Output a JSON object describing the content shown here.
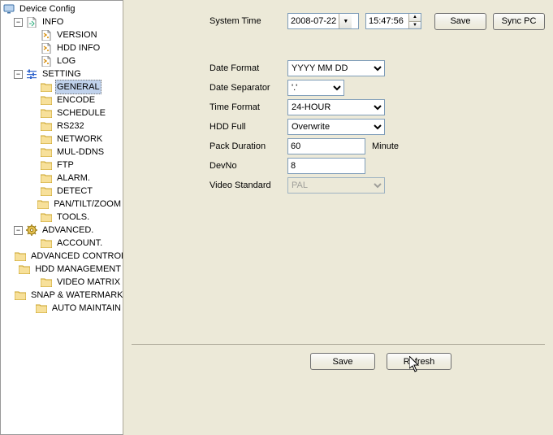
{
  "tree": {
    "root_label": "Device Config",
    "info": {
      "label": "INFO",
      "children": [
        "VERSION",
        "HDD INFO",
        "LOG"
      ]
    },
    "setting": {
      "label": "SETTING",
      "children": [
        "GENERAL",
        "ENCODE",
        "SCHEDULE",
        "RS232",
        "NETWORK",
        "MUL-DDNS",
        "FTP",
        "ALARM.",
        "DETECT",
        "PAN/TILT/ZOOM",
        "TOOLS."
      ]
    },
    "advanced": {
      "label": "ADVANCED.",
      "children": [
        "ACCOUNT.",
        "ADVANCED CONTROL.",
        "HDD MANAGEMENT",
        "VIDEO MATRIX",
        "SNAP & WATERMARK",
        "AUTO MAINTAIN"
      ]
    },
    "selected": "GENERAL"
  },
  "top": {
    "system_time_label": "System Time",
    "date_value": "2008-07-22",
    "time_value": "15:47:56",
    "save_label": "Save",
    "sync_label": "Sync PC"
  },
  "form": {
    "date_format_label": "Date Format",
    "date_format_value": "YYYY MM DD",
    "date_separator_label": "Date Separator",
    "date_separator_value": "'.'",
    "time_format_label": "Time Format",
    "time_format_value": "24-HOUR",
    "hdd_full_label": "HDD Full",
    "hdd_full_value": "Overwrite",
    "pack_duration_label": "Pack Duration",
    "pack_duration_value": "60",
    "pack_duration_unit": "Minute",
    "devno_label": "DevNo",
    "devno_value": "8",
    "video_standard_label": "Video Standard",
    "video_standard_value": "PAL"
  },
  "bottom": {
    "save_label": "Save",
    "refresh_label": "Refresh"
  }
}
